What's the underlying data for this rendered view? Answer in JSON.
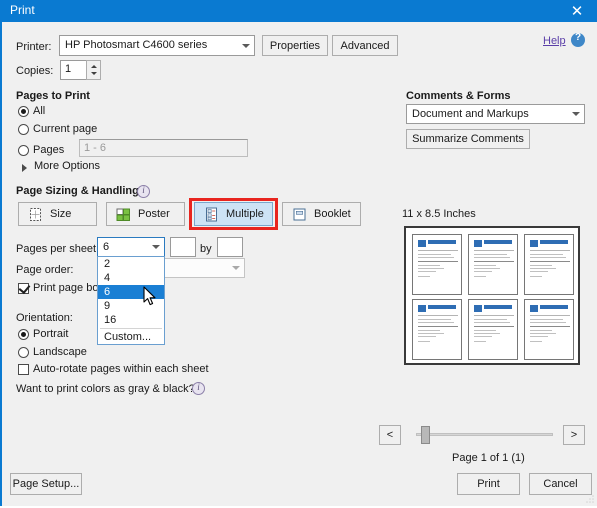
{
  "window": {
    "title": "Print",
    "close_icon": "close-icon"
  },
  "printer": {
    "label": "Printer:",
    "value": "HP Photosmart C4600 series",
    "properties_button": "Properties",
    "advanced_button": "Advanced"
  },
  "help": {
    "link": "Help",
    "icon": "help-question-icon"
  },
  "copies": {
    "label": "Copies:",
    "value": "1"
  },
  "pages_to_print": {
    "heading": "Pages to Print",
    "options": [
      {
        "label": "All",
        "selected": true
      },
      {
        "label": "Current page",
        "selected": false
      },
      {
        "label": "Pages",
        "selected": false
      }
    ],
    "pages_range_value": "1 - 6",
    "more_options": "More Options"
  },
  "page_sizing": {
    "heading": "Page Sizing & Handling",
    "info_icon": "info-icon",
    "buttons": [
      {
        "label": "Size",
        "icon": "size-icon",
        "selected": false
      },
      {
        "label": "Poster",
        "icon": "poster-icon",
        "selected": false
      },
      {
        "label": "Multiple",
        "icon": "multiple-icon",
        "selected": true
      },
      {
        "label": "Booklet",
        "icon": "booklet-icon",
        "selected": false
      }
    ],
    "highlight_color": "#e8251f",
    "pages_per_sheet": {
      "label": "Pages per sheet:",
      "value": "6",
      "by_label": "by",
      "custom_x": "",
      "custom_y": "",
      "options": [
        "2",
        "4",
        "6",
        "9",
        "16",
        "Custom..."
      ],
      "highlighted_option": "6"
    },
    "page_order": {
      "label": "Page order:",
      "value": ""
    },
    "print_page_border": {
      "label": "Print page border",
      "checked": true
    },
    "orientation": {
      "label": "Orientation:",
      "options": [
        {
          "label": "Portrait",
          "selected": true
        },
        {
          "label": "Landscape",
          "selected": false
        }
      ]
    },
    "auto_rotate": {
      "label": "Auto-rotate pages within each sheet",
      "checked": false
    },
    "gray_black": {
      "label": "Want to print colors as gray & black?",
      "info_icon": "info-icon"
    }
  },
  "comments_forms": {
    "heading": "Comments & Forms",
    "value": "Document and Markups",
    "summarize_button": "Summarize Comments"
  },
  "preview": {
    "size_label": "11 x 8.5 Inches",
    "page_status": "Page 1 of 1 (1)",
    "prev_button": "<",
    "next_button": ">",
    "thumbnail_count": 6,
    "thumbnail_title_color": "#2e6db4"
  },
  "footer": {
    "page_setup_button": "Page Setup...",
    "print_button": "Print",
    "cancel_button": "Cancel"
  }
}
